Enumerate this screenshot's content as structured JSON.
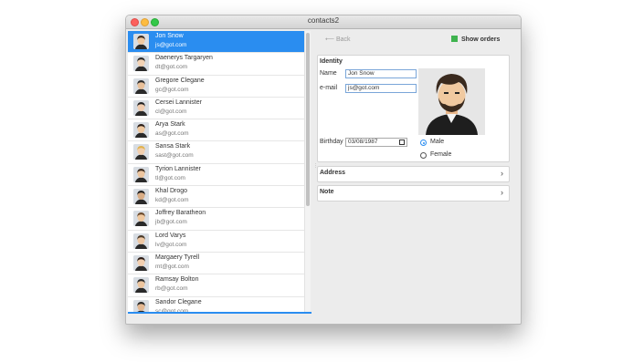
{
  "window": {
    "title": "contacts2"
  },
  "contacts": [
    {
      "name": "Jon Snow",
      "email": "js@got.com",
      "selected": true,
      "hair": "#3a2a1e",
      "skin": "#f0c9a0"
    },
    {
      "name": "Daenerys Targaryen",
      "email": "dt@got.com",
      "hair": "#2b2b2b",
      "skin": "#f3d3b5"
    },
    {
      "name": "Gregore Clegane",
      "email": "gc@got.com",
      "hair": "#2a2a2a",
      "skin": "#e8c09a"
    },
    {
      "name": "Cersei Lannister",
      "email": "cl@got.com",
      "hair": "#222222",
      "skin": "#f1cdb0"
    },
    {
      "name": "Arya Stark",
      "email": "as@got.com",
      "hair": "#2b1e18",
      "skin": "#f0c9a0"
    },
    {
      "name": "Sansa Stark",
      "email": "sast@got.com",
      "hair": "#e2b24a",
      "skin": "#f2cfae"
    },
    {
      "name": "Tyrion Lannister",
      "email": "tl@got.com",
      "hair": "#3b2a1d",
      "skin": "#ecc59f"
    },
    {
      "name": "Khal Drogo",
      "email": "kd@got.com",
      "hair": "#1c1c1c",
      "skin": "#d9ad86"
    },
    {
      "name": "Joffrey Baratheon",
      "email": "jb@got.com",
      "hair": "#6b4a2b",
      "skin": "#f0c9a0"
    },
    {
      "name": "Lord Varys",
      "email": "lv@got.com",
      "hair": "#4a3a2a",
      "skin": "#eec7a3"
    },
    {
      "name": "Margaery Tyrell",
      "email": "mt@got.com",
      "hair": "#2a1c16",
      "skin": "#f2cfb0"
    },
    {
      "name": "Ramsay Bolton",
      "email": "rb@got.com",
      "hair": "#2a2a2a",
      "skin": "#ecc59f"
    },
    {
      "name": "Sandor Clegane",
      "email": "sc@got.com",
      "hair": "#262626",
      "skin": "#e3b893"
    }
  ],
  "toolbar": {
    "back_label": "Back",
    "show_orders_label": "Show orders",
    "accent": "#3fb34f"
  },
  "identity": {
    "title": "Identity",
    "name_label": "Name",
    "name_value": "Jon Snow",
    "email_label": "e-mail",
    "email_value": "js@got.com",
    "birthday_label": "Birthday",
    "birthday_value": "03/08/1987",
    "gender_options": [
      "Male",
      "Female"
    ],
    "gender_selected": "Male"
  },
  "sections": {
    "address_label": "Address",
    "note_label": "Note"
  },
  "colors": {
    "selection": "#2a8df0",
    "field_border": "#7aa6d9"
  }
}
